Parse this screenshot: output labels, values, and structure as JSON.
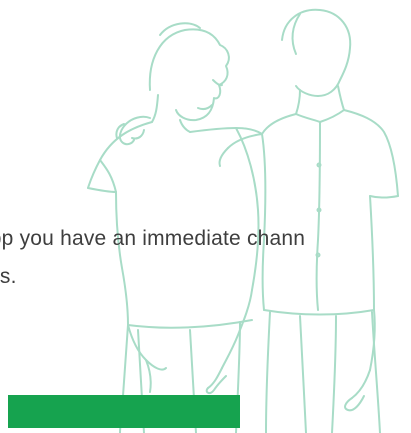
{
  "content": {
    "line_1": "e app you have an immediate chann",
    "line_2": "us."
  },
  "cta": {
    "label": ""
  },
  "colors": {
    "illustration_stroke": "#a8dcc7",
    "button_fill": "#16a34f",
    "text": "#3e3e3e"
  },
  "illustration": {
    "icon": "two-friends-line-art"
  }
}
